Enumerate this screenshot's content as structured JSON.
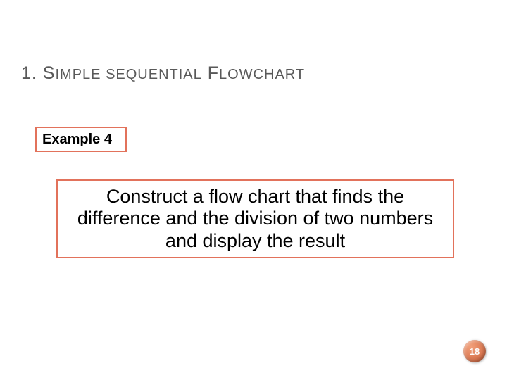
{
  "title": {
    "part1_big": "1. S",
    "part1_sm": "IMPLE",
    "part2_sm": " SEQUENTIAL",
    "part3_big": " F",
    "part3_sm": "LOWCHART"
  },
  "example_label": "Example 4",
  "body_text": "Construct a flow chart that finds the difference and the division of two numbers and display the result",
  "page_number": "18"
}
